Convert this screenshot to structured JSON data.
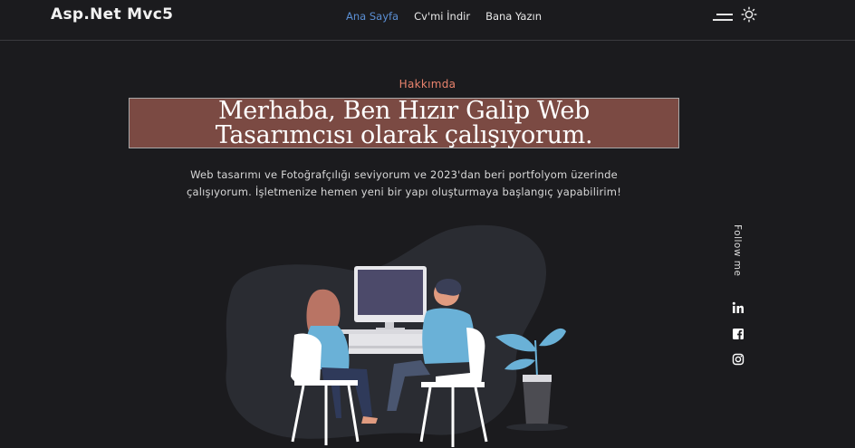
{
  "nav": {
    "brand": "Asp.Net Mvc5",
    "items": [
      {
        "label": "Ana Sayfa",
        "active": true
      },
      {
        "label": "Cv'mi İndir",
        "active": false
      },
      {
        "label": "Bana Yazın",
        "active": false
      }
    ],
    "icons": [
      "menu-icon",
      "sun-icon"
    ]
  },
  "hero": {
    "eyebrow": "Hakkımda",
    "title_line1": "Merhaba, Ben Hızır Galip Web",
    "title_line2": "Tasarımcısı olarak çalışıyorum.",
    "description_line1": "Web tasarımı ve Fotoğrafçılığı seviyorum ve 2023'dan beri portfolyom üzerinde",
    "description_line2": "çalışıyorum. İşletmenize hemen yeni bir yapı oluşturmaya başlangıç yapabilirim!"
  },
  "social": {
    "follow_label": "Follow me",
    "icons": [
      "linkedin-icon",
      "facebook-icon",
      "instagram-icon"
    ]
  },
  "colors": {
    "background": "#1b1b1e",
    "accent_blue": "#5b8fd4",
    "eyebrow": "#e9836d",
    "title_box": "#7b4a43",
    "blob": "#2a2c32"
  }
}
